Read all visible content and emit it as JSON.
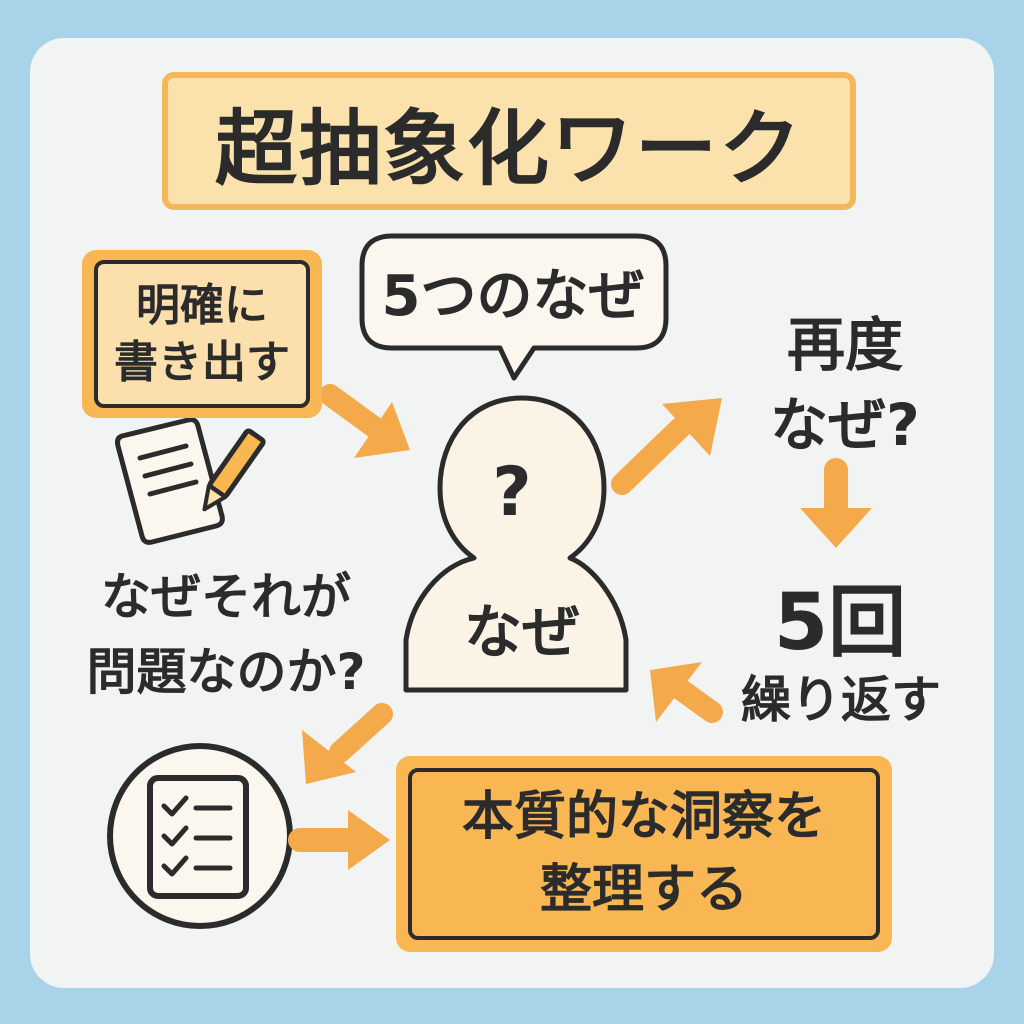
{
  "title": "超抽象化ワーク",
  "write_box": {
    "line1": "明確に",
    "line2": "書き出す"
  },
  "bubble": {
    "text": "5つのなぜ"
  },
  "person": {
    "head_symbol": "?",
    "body_text": "なぜ"
  },
  "again": {
    "line1": "再度",
    "line2": "なぜ?"
  },
  "repeat": {
    "number": "5回",
    "text": "繰り返す"
  },
  "question": {
    "line1": "なぜそれが",
    "line2": "問題なのか?"
  },
  "insight_box": {
    "line1": "本質的な洞察を",
    "line2": "整理する"
  },
  "colors": {
    "accent": "#f8b753",
    "accent_light": "#fbe2ad",
    "background": "#a9d3e8",
    "card": "#f1f4f2",
    "ink": "#2b2b2b"
  },
  "icons": [
    "document-pencil-icon",
    "checklist-icon",
    "person-icon"
  ]
}
